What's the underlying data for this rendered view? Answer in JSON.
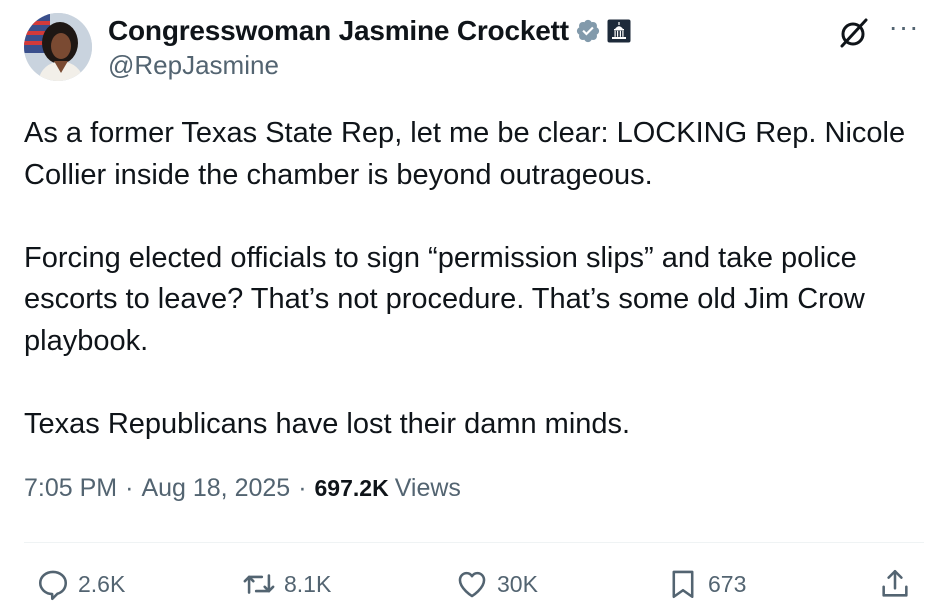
{
  "author": {
    "display_name": "Congresswoman Jasmine Crockett",
    "handle": "@RepJasmine",
    "verified_icon": "verified-badge-icon",
    "affiliation_icon": "us-capitol-icon",
    "colors": {
      "verified": "#829aab",
      "affiliation_badge": "#1d2a3a"
    }
  },
  "header_actions": {
    "grok_icon": "grok-icon",
    "more_label": "···"
  },
  "tweet": {
    "paragraphs": [
      "As a former Texas State Rep, let me be clear: LOCKING Rep. Nicole Collier inside the chamber is beyond outrageous.",
      "Forcing elected officials to sign “permission slips” and take police escorts to leave? That’s not procedure. That’s some old Jim Crow playbook.",
      "Texas Republicans have lost their damn minds."
    ]
  },
  "meta": {
    "time": "7:05 PM",
    "date": "Aug 18, 2025",
    "separator": "·",
    "views_count": "697.2K",
    "views_label": "Views"
  },
  "actions": {
    "reply": {
      "icon": "reply-icon",
      "count": "2.6K"
    },
    "repost": {
      "icon": "repost-icon",
      "count": "8.1K"
    },
    "like": {
      "icon": "heart-icon",
      "count": "30K"
    },
    "bookmark": {
      "icon": "bookmark-icon",
      "count": "673"
    },
    "share": {
      "icon": "share-icon"
    }
  },
  "colors": {
    "text": "#0f1419",
    "secondary": "#536471",
    "divider": "#eff3f4"
  }
}
